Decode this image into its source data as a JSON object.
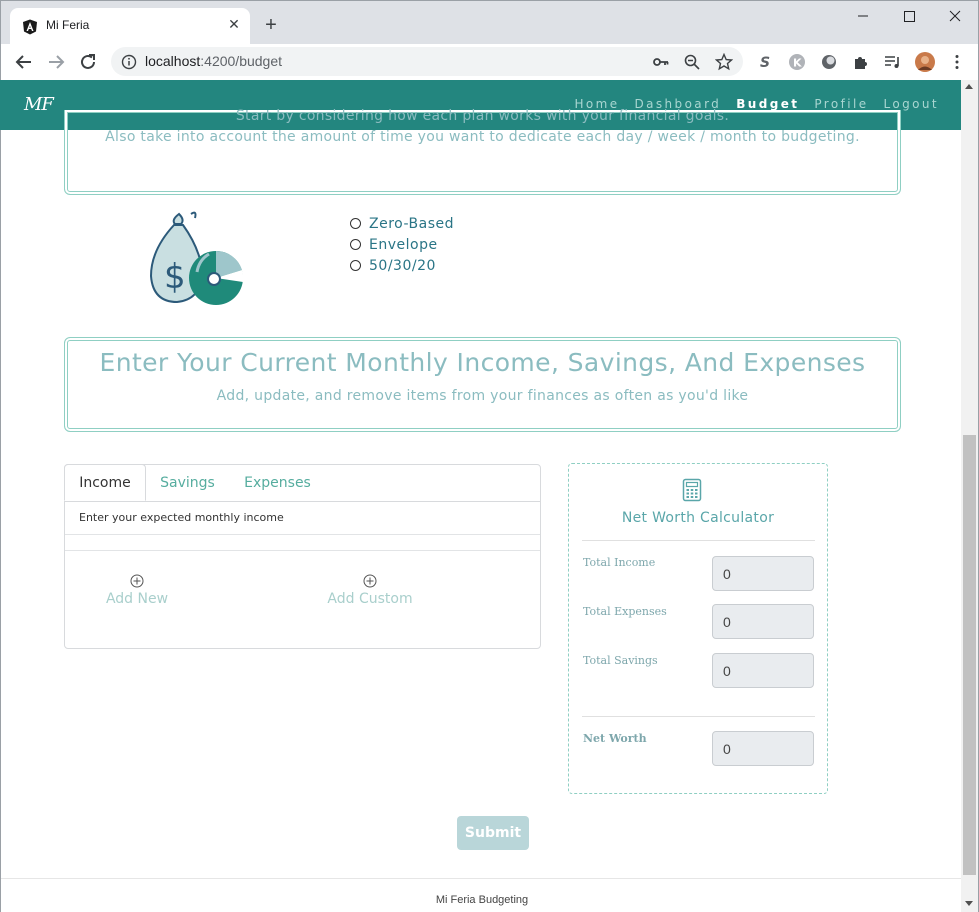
{
  "browser": {
    "tab_title": "Mi Feria",
    "url_host": "localhost",
    "url_path": ":4200/budget"
  },
  "nav": {
    "brand": "MF",
    "links": [
      {
        "label": "Home"
      },
      {
        "label": "Dashboard"
      },
      {
        "label": "Budget",
        "active": true
      },
      {
        "label": "Profile"
      },
      {
        "label": "Logout"
      }
    ],
    "color": "#23867f"
  },
  "intro": {
    "line1": "Start by considering how each plan works with your financial goals.",
    "line2": "Also take into account the amount of time you want to dedicate each day / week / month to budgeting."
  },
  "plans": {
    "options": [
      "Zero-Based",
      "Envelope",
      "50/30/20"
    ]
  },
  "finances": {
    "title": "Enter Your Current Monthly Income, Savings, And Expenses",
    "subtitle": "Add, update, and remove items from your finances as often as you'd like"
  },
  "tabs": {
    "items": [
      "Income",
      "Savings",
      "Expenses"
    ],
    "active": "Income",
    "hint": "Enter your expected monthly income",
    "add_new": "Add New",
    "add_custom": "Add Custom"
  },
  "calculator": {
    "title": "Net Worth Calculator",
    "total_income_label": "Total Income",
    "total_income_value": "0",
    "total_expenses_label": "Total Expenses",
    "total_expenses_value": "0",
    "total_savings_label": "Total Savings",
    "total_savings_value": "0",
    "net_worth_label": "Net Worth",
    "net_worth_value": "0"
  },
  "submit_label": "Submit",
  "footer": "Mi Feria Budgeting"
}
